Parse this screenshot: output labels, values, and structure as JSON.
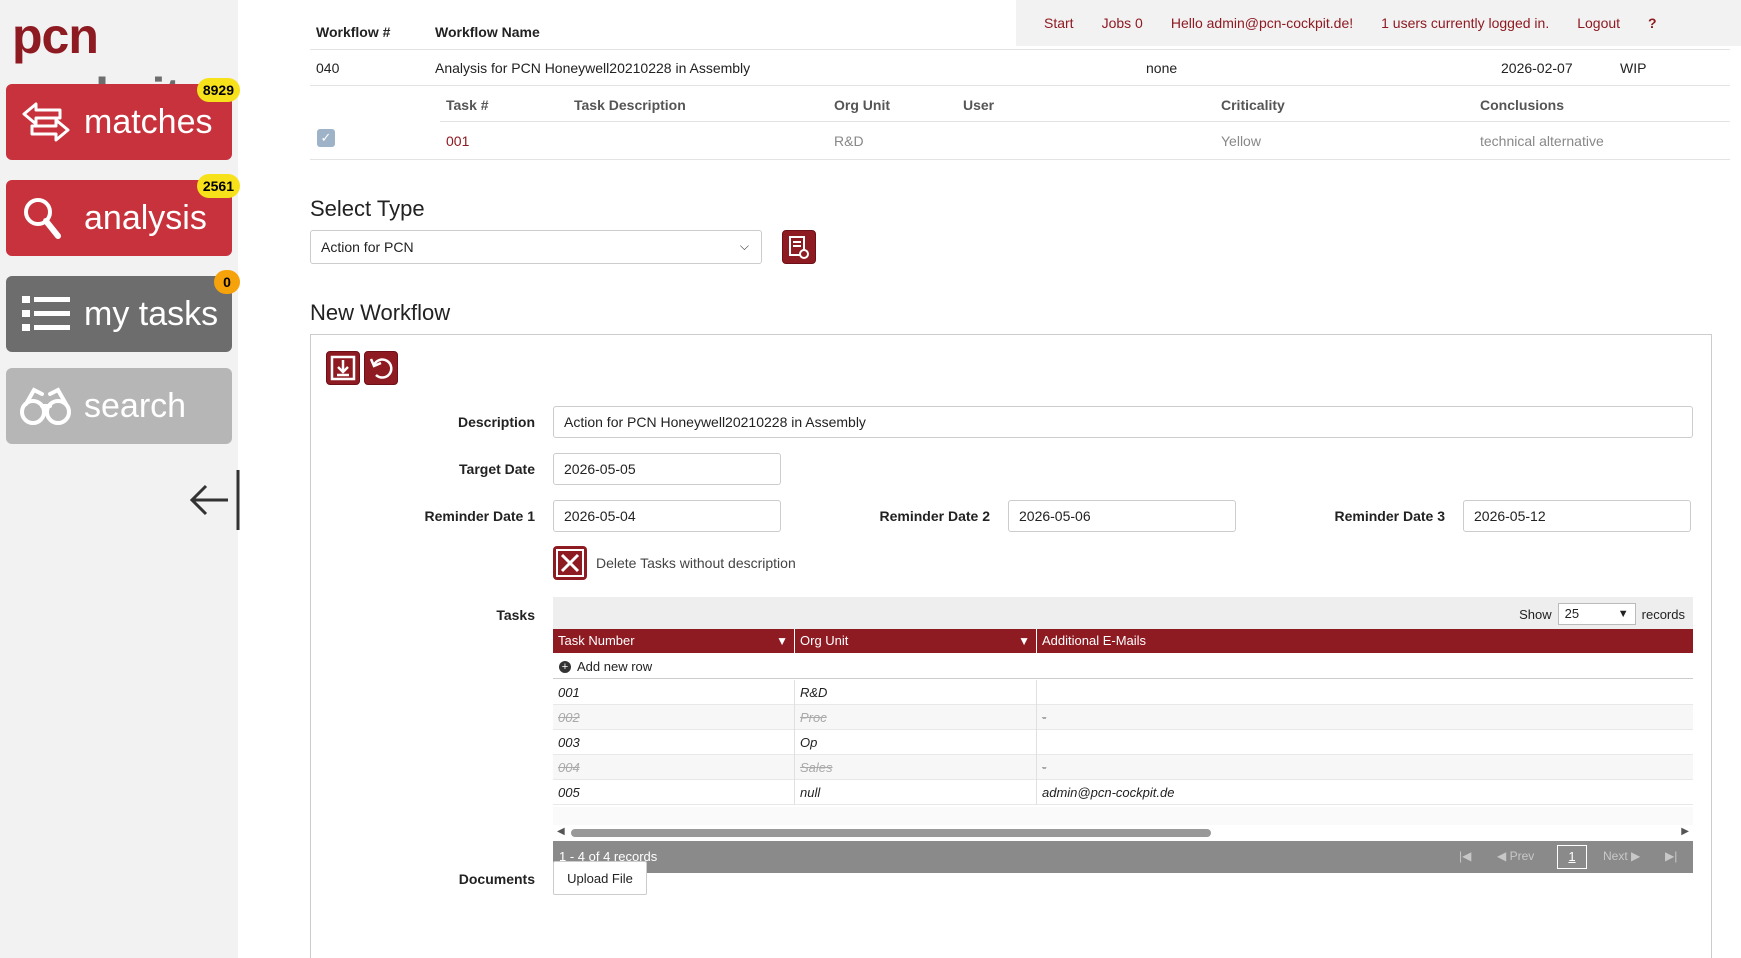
{
  "brand": {
    "part1": "pcn",
    "part2": "cockpit"
  },
  "sidebar": {
    "items": [
      {
        "label": "matches",
        "badge": "8929"
      },
      {
        "label": "analysis",
        "badge": "2561"
      },
      {
        "label": "my tasks",
        "badge": "0"
      },
      {
        "label": "search"
      }
    ]
  },
  "topnav": {
    "start": "Start",
    "jobs": "Jobs 0",
    "hello": "Hello admin@pcn-cockpit.de!",
    "users": "1 users currently logged in.",
    "logout": "Logout",
    "help": "?"
  },
  "workflow_table": {
    "headers": {
      "number": "Workflow #",
      "name": "Workflow Name"
    },
    "row": {
      "number": "040",
      "name": "Analysis for PCN Honeywell20210228 in Assembly",
      "user": "none",
      "date": "2026-02-07",
      "status": "WIP"
    },
    "task_headers": {
      "task": "Task #",
      "description": "Task Description",
      "org": "Org Unit",
      "user": "User",
      "criticality": "Criticality",
      "conclusions": "Conclusions"
    },
    "task_row": {
      "task": "001",
      "description": "",
      "org": "R&D",
      "user": "",
      "criticality": "Yellow",
      "conclusions": "technical alternative"
    }
  },
  "select_type": {
    "heading": "Select Type",
    "value": "Action for PCN"
  },
  "new_workflow": {
    "heading": "New Workflow",
    "labels": {
      "description": "Description",
      "target_date": "Target Date",
      "reminder1": "Reminder Date 1",
      "reminder2": "Reminder Date 2",
      "reminder3": "Reminder Date 3",
      "tasks": "Tasks",
      "documents": "Documents"
    },
    "values": {
      "description": "Action for PCN Honeywell20210228 in Assembly",
      "target_date": "2026-05-05",
      "reminder1": "2026-05-04",
      "reminder2": "2026-05-06",
      "reminder3": "2026-05-12"
    },
    "delete_tasks_label": "Delete Tasks without description",
    "upload_label": "Upload File"
  },
  "tasks_grid": {
    "show_label": "Show",
    "show_value": "25",
    "records_label": "records",
    "columns": [
      "Task Number",
      "Org Unit",
      "Additional E-Mails"
    ],
    "add_row_label": "Add new row",
    "rows": [
      {
        "task": "001",
        "org": "R&D",
        "emails": "",
        "deleted": false
      },
      {
        "task": "002",
        "org": "Proc",
        "emails": "-",
        "deleted": true
      },
      {
        "task": "003",
        "org": "Op",
        "emails": "",
        "deleted": false
      },
      {
        "task": "004",
        "org": "Sales",
        "emails": "-",
        "deleted": true
      },
      {
        "task": "005",
        "org": "null",
        "emails": "admin@pcn-cockpit.de",
        "deleted": false
      }
    ],
    "pager": {
      "info": "1 - 4 of 4 records",
      "prev": "Prev",
      "next": "Next",
      "page": "1"
    }
  },
  "colors": {
    "brand_red": "#8e1a22",
    "nav_red": "#c7323c",
    "badge_yellow": "#f7e11b",
    "badge_orange": "#f5a20b"
  }
}
